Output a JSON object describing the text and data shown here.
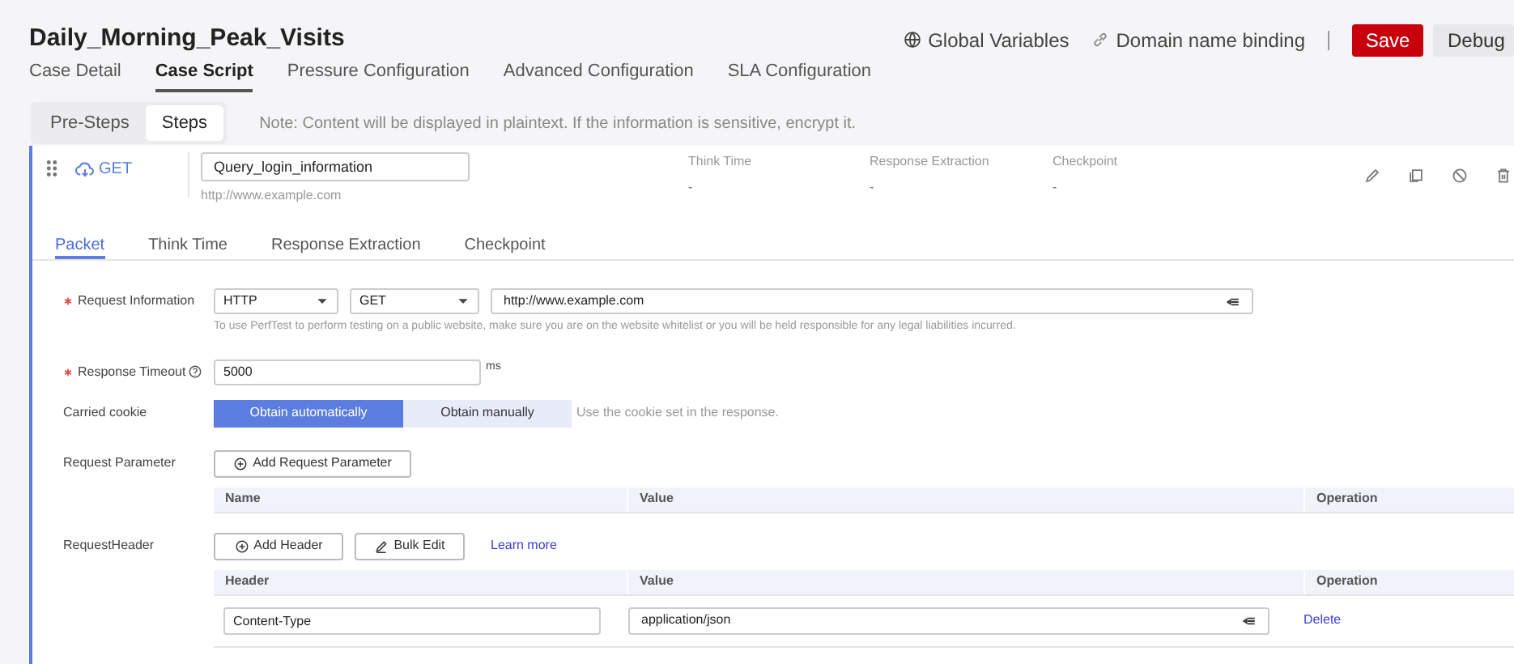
{
  "title": "Daily_Morning_Peak_Visits",
  "header_actions": [
    {
      "kind": "globe",
      "label": "Global Variables"
    },
    {
      "kind": "link",
      "label": "Domain name binding"
    }
  ],
  "buttons": [
    {
      "kind": "primary",
      "label": "Save"
    },
    {
      "kind": "default",
      "label": "Debug"
    }
  ],
  "tabs": [
    {
      "label": "Case Detail",
      "selected": false
    },
    {
      "label": "Case Script",
      "selected": true
    },
    {
      "label": "Pressure Configuration",
      "selected": false
    },
    {
      "label": "Advanced Configuration",
      "selected": false
    },
    {
      "label": "SLA Configuration",
      "selected": false
    }
  ],
  "step_switch": [
    {
      "label": "Pre-Steps",
      "selected": false
    },
    {
      "label": "Steps",
      "selected": true
    }
  ],
  "note": "Note: Content will be displayed in plaintext. If the information is sensitive, encrypt it.",
  "step": {
    "method": "GET",
    "name": "Query_login_information",
    "url": "http://www.example.com",
    "summary": [
      {
        "label": "Think Time",
        "value": "-"
      },
      {
        "label": "Response Extraction",
        "value": "-"
      },
      {
        "label": "Checkpoint",
        "value": "-"
      }
    ]
  },
  "inner_tabs": [
    {
      "label": "Packet",
      "selected": true
    },
    {
      "label": "Think Time",
      "selected": false
    },
    {
      "label": "Response Extraction",
      "selected": false
    },
    {
      "label": "Checkpoint",
      "selected": false
    }
  ],
  "request_information": {
    "label": "Request Information",
    "required": true,
    "protocol": "HTTP",
    "method": "GET",
    "url": "http://www.example.com",
    "hint": "To use PerfTest to perform testing on a public website, make sure you are on the website whitelist or you will be held responsible for any legal liabilities incurred."
  },
  "response_timeout": {
    "label": "Response Timeout",
    "required": true,
    "value": "5000",
    "unit": "ms"
  },
  "carried_cookie": {
    "label": "Carried cookie",
    "options": [
      {
        "label": "Obtain automatically",
        "selected": true
      },
      {
        "label": "Obtain manually",
        "selected": false
      }
    ],
    "hint": "Use the cookie set in the response."
  },
  "request_parameter": {
    "label": "Request Parameter",
    "button": "Add Request Parameter",
    "columns": [
      "Name",
      "Value",
      "Operation"
    ]
  },
  "request_header": {
    "label": "RequestHeader",
    "buttons": [
      {
        "kind": "add",
        "label": "Add Header"
      },
      {
        "kind": "edit",
        "label": "Bulk Edit"
      }
    ],
    "link": "Learn more",
    "columns": [
      "Header",
      "Value",
      "Operation"
    ],
    "rows": [
      {
        "header": "Content-Type",
        "value": "application/json",
        "action": "Delete"
      }
    ]
  }
}
